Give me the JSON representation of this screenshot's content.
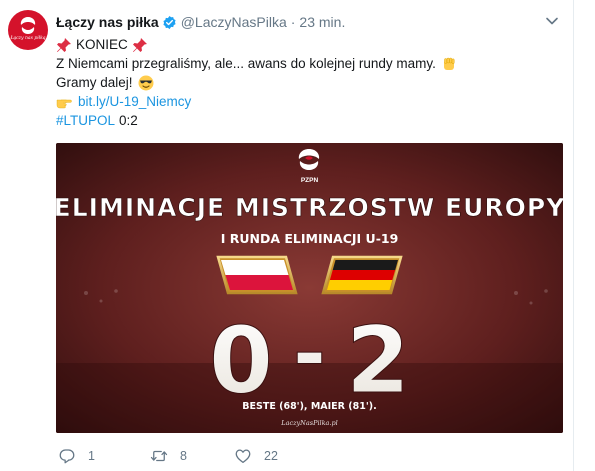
{
  "tweet": {
    "author_name": "Łączy nas piłka",
    "handle": "@LaczyNasPilka",
    "separator": "·",
    "time": "23 min.",
    "avatar_caption": "Łączy nas piłką",
    "lines": {
      "koniec": "KONIEC",
      "line2": "Z Niemcami przegraliśmy, ale... awans do kolejnej rundy mamy.",
      "line3": "Gramy dalej!",
      "link": "bit.ly/U-19_Niemcy",
      "hashtag": "#LTUPOL",
      "score_text": "0:2"
    },
    "icons": [
      "verified-badge-icon",
      "caret-down-icon",
      "pushpin-icon",
      "raised-fist-icon",
      "cool-face-icon",
      "pointing-hand-icon",
      "reply-icon",
      "retweet-icon",
      "heart-icon",
      "pzpn-eagle-icon"
    ],
    "colors": {
      "link": "#1b95e0",
      "muted": "#657786",
      "text": "#14171a",
      "brand_red": "#d4122b"
    }
  },
  "media": {
    "pzpn": "PZPN",
    "title": "ELIMINACJE MISTRZOSTW EUROPY",
    "subtitle": "I RUNDA ELIMINACJI U-19",
    "score_home": "0",
    "score_dash": "-",
    "score_away": "2",
    "scorers": "BESTE (68'), MAIER (81').",
    "watermark": "LaczyNasPilka.pl",
    "flag_home": "Poland",
    "flag_away": "Germany"
  },
  "actions": {
    "replies": "1",
    "retweets": "8",
    "likes": "22"
  }
}
